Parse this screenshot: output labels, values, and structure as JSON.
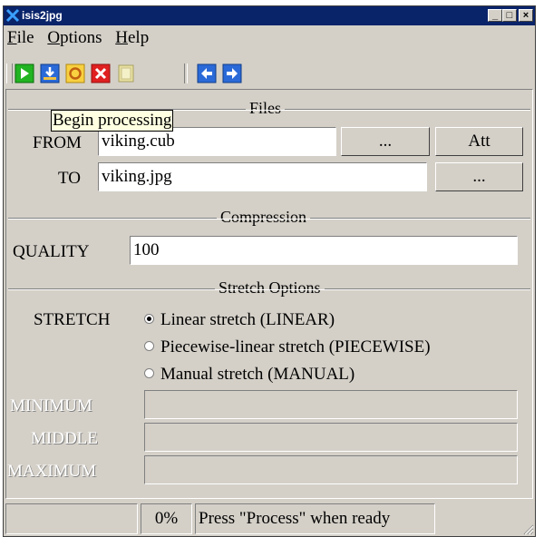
{
  "window": {
    "title": "isis2jpg",
    "minimize": "_",
    "maximize": "□",
    "close": "×"
  },
  "menu": [
    {
      "accel": "F",
      "rest": "ile"
    },
    {
      "accel": "O",
      "rest": "ptions"
    },
    {
      "accel": "H",
      "rest": "elp"
    }
  ],
  "toolbar": {
    "icons": [
      "play-icon",
      "import-icon",
      "reset-icon",
      "cancel-icon",
      "clipboard-icon",
      "back-arrow-icon",
      "forward-arrow-icon"
    ]
  },
  "tooltip": "Begin processing",
  "files": {
    "title": "Files",
    "from_label": "FROM",
    "from_value": "viking.cub",
    "to_label": "TO",
    "to_value": "viking.jpg",
    "browse_label": "...",
    "att_label": "Att"
  },
  "compression": {
    "title": "Compression",
    "quality_label": "QUALITY",
    "quality_value": "100"
  },
  "stretch": {
    "title": "Stretch Options",
    "stretch_label": "STRETCH",
    "options": [
      {
        "label": "Linear stretch (LINEAR)",
        "selected": true
      },
      {
        "label": "Piecewise-linear stretch (PIECEWISE)",
        "selected": false
      },
      {
        "label": "Manual stretch (MANUAL)",
        "selected": false
      }
    ],
    "minimum_label": "MINIMUM",
    "middle_label": "MIDDLE",
    "maximum_label": "MAXIMUM"
  },
  "statusbar": {
    "progress": "0%",
    "message": "Press \"Process\" when ready"
  },
  "colors": {
    "titlebar": "#0a246a",
    "face": "#d4d0c8",
    "tooltip": "#ffffe1"
  }
}
